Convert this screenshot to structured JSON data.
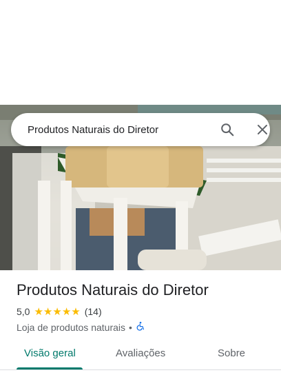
{
  "search": {
    "query": "Produtos Naturais do Diretor"
  },
  "place": {
    "name": "Produtos Naturais do Diretor",
    "rating": "5,0",
    "stars": 5,
    "review_count": "(14)",
    "category": "Loja de produtos naturais",
    "separator": "•",
    "accessibility_icon": "wheelchair-icon"
  },
  "tabs": [
    {
      "label": "Visão geral",
      "active": true
    },
    {
      "label": "Avaliações",
      "active": false
    },
    {
      "label": "Sobre",
      "active": false
    }
  ],
  "colors": {
    "accent": "#00796b",
    "star": "#fbbc04",
    "accessibility": "#1a73e8"
  }
}
